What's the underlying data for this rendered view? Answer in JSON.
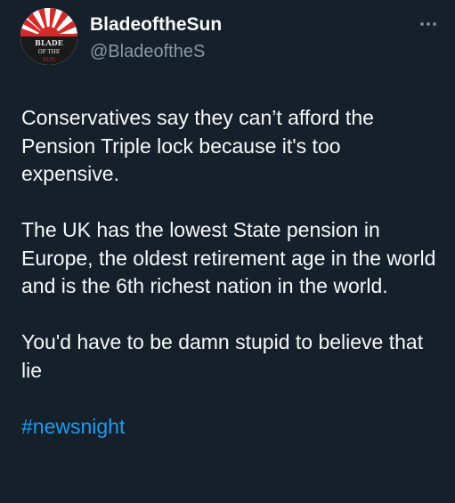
{
  "author": {
    "display_name": "BladeoftheSun",
    "handle": "@BladeoftheS",
    "avatar_text": [
      "BLADE",
      "OF THE",
      "SUN"
    ]
  },
  "tweet": {
    "paragraph_1": "Conservatives say they can’t afford the Pension Triple lock because it's too expensive.",
    "paragraph_2": "The UK has the lowest State pension in Europe, the oldest retirement age in the world and is the 6th richest nation in the world.",
    "paragraph_3": "You'd have to be damn stupid to believe that lie",
    "hashtag": "#newsnight"
  },
  "icons": {
    "more": "more-horizontal-icon"
  },
  "colors": {
    "background": "#15202b",
    "text": "#f7f9f9",
    "secondary_text": "#8b98a5",
    "link": "#1d9bf0",
    "avatar_red": "#d42a2a"
  }
}
